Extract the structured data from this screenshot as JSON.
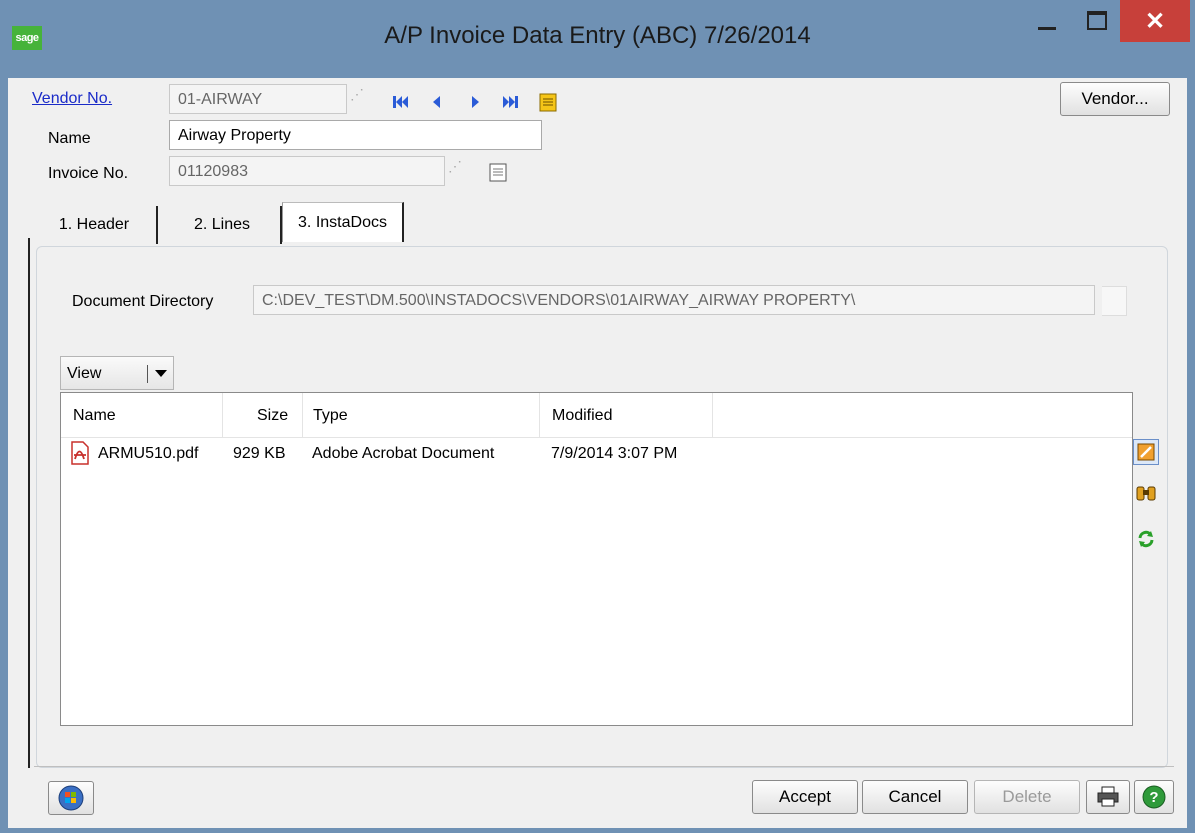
{
  "window": {
    "logo_text": "sage",
    "title": "A/P Invoice Data Entry (ABC) 7/26/2014",
    "close_label": "✕"
  },
  "form": {
    "vendor_label": "Vendor No.",
    "vendor_value": "01-AIRWAY",
    "name_label": "Name",
    "name_value": "Airway Property",
    "invoice_label": "Invoice No.",
    "invoice_value": "01120983",
    "vendor_button": "Vendor..."
  },
  "tabs": [
    {
      "label": "1. Header"
    },
    {
      "label": "2. Lines"
    },
    {
      "label": "3. InstaDocs"
    }
  ],
  "instadocs": {
    "dir_label": "Document Directory",
    "dir_value": "C:\\DEV_TEST\\DM.500\\INSTADOCS\\VENDORS\\01AIRWAY_AIRWAY PROPERTY\\",
    "view_label": "View",
    "columns": [
      "Name",
      "Size",
      "Type",
      "Modified"
    ],
    "rows": [
      {
        "name": "ARMU510.pdf",
        "size": "929 KB",
        "type": "Adobe Acrobat Document",
        "modified": "7/9/2014 3:07 PM"
      }
    ]
  },
  "footer": {
    "accept": "Accept",
    "cancel": "Cancel",
    "delete": "Delete"
  },
  "colors": {
    "titlebar": "#6f91b4",
    "close": "#c7403a",
    "link": "#1a2bc8",
    "pdf_icon": "#c8302c"
  }
}
